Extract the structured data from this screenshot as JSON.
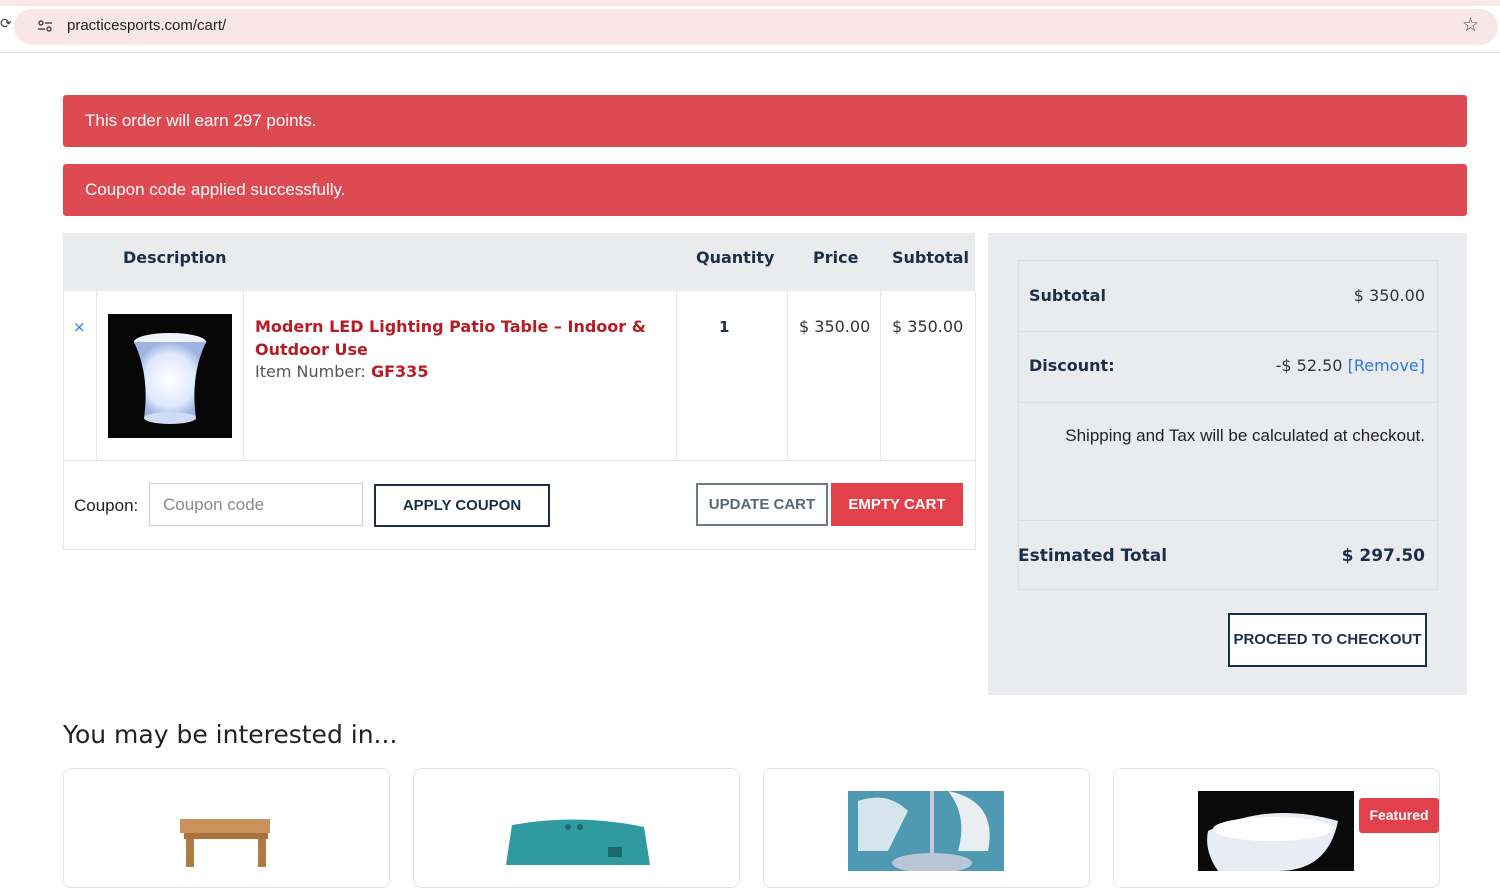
{
  "browser": {
    "url": "practicesports.com/cart/"
  },
  "notices": {
    "points": "This order will earn 297 points.",
    "coupon": "Coupon code applied successfully."
  },
  "cart": {
    "headers": {
      "description": "Description",
      "quantity": "Quantity",
      "price": "Price",
      "subtotal": "Subtotal"
    },
    "items": [
      {
        "remove_icon": "×",
        "title": "Modern LED Lighting Patio Table – Indoor & Outdoor Use",
        "item_number_label": "Item Number:",
        "item_number": "GF335",
        "quantity": "1",
        "price": "$ 350.00",
        "subtotal": "$ 350.00"
      }
    ],
    "coupon_label": "Coupon:",
    "coupon_placeholder": "Coupon code",
    "apply_coupon": "APPLY COUPON",
    "update_cart": "UPDATE CART",
    "empty_cart": "EMPTY CART"
  },
  "totals": {
    "subtotal_label": "Subtotal",
    "subtotal_value": "$ 350.00",
    "discount_label": "Discount:",
    "discount_value": "-$ 52.50",
    "discount_remove": "[Remove]",
    "shipping_note": "Shipping and Tax will be calculated at checkout.",
    "estimated_label": "Estimated Total",
    "estimated_value": "$ 297.50",
    "checkout_button": "PROCEED TO CHECKOUT"
  },
  "related": {
    "heading": "You may be interested in...",
    "featured_badge": "Featured"
  },
  "colors": {
    "notice_red": "#de4a52",
    "navy": "#1b2f4a",
    "product_red": "#b71c24",
    "link_blue": "#2c7be5"
  },
  "icons": [
    "reload-icon",
    "site-settings-icon",
    "star-icon",
    "remove-icon"
  ]
}
